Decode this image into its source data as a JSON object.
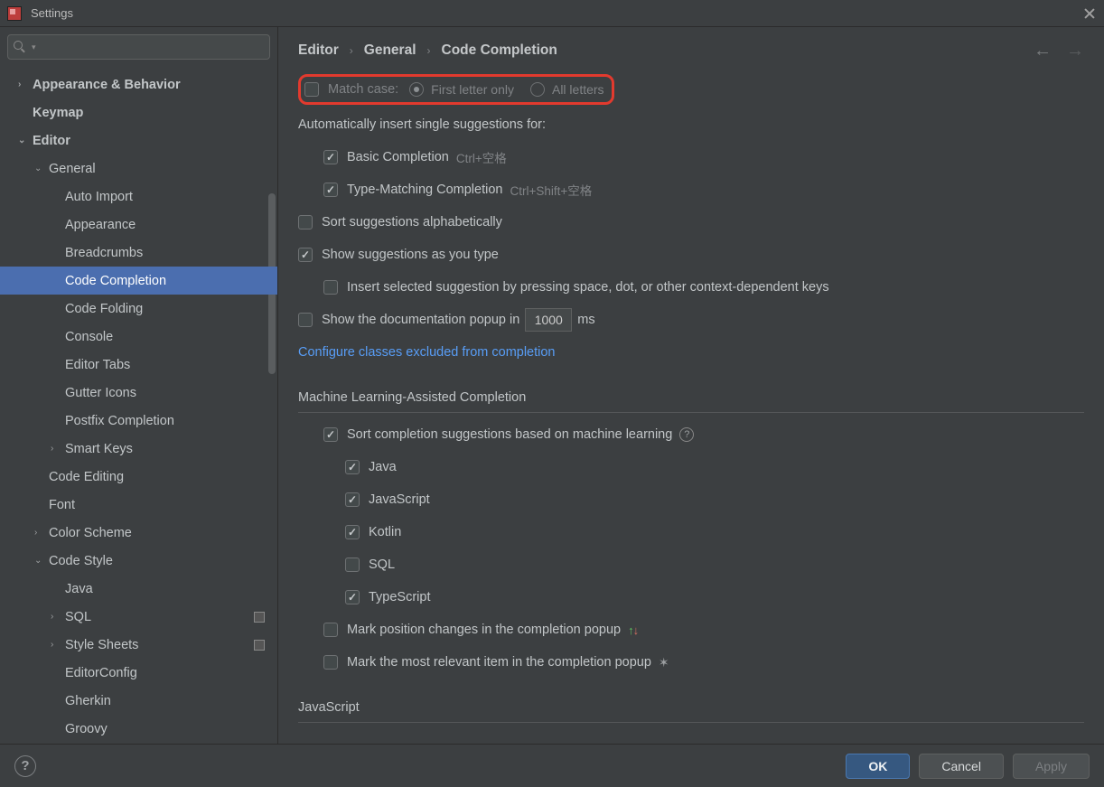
{
  "window": {
    "title": "Settings"
  },
  "sidebar": {
    "search_placeholder": "",
    "items": [
      {
        "label": "Appearance & Behavior",
        "depth": 0,
        "arrow": "right",
        "bold": true
      },
      {
        "label": "Keymap",
        "depth": 0,
        "arrow": "none",
        "bold": true
      },
      {
        "label": "Editor",
        "depth": 0,
        "arrow": "down",
        "bold": true
      },
      {
        "label": "General",
        "depth": 1,
        "arrow": "down",
        "bold": false
      },
      {
        "label": "Auto Import",
        "depth": 2,
        "arrow": "none"
      },
      {
        "label": "Appearance",
        "depth": 2,
        "arrow": "none"
      },
      {
        "label": "Breadcrumbs",
        "depth": 2,
        "arrow": "none"
      },
      {
        "label": "Code Completion",
        "depth": 2,
        "arrow": "none",
        "selected": true
      },
      {
        "label": "Code Folding",
        "depth": 2,
        "arrow": "none"
      },
      {
        "label": "Console",
        "depth": 2,
        "arrow": "none"
      },
      {
        "label": "Editor Tabs",
        "depth": 2,
        "arrow": "none"
      },
      {
        "label": "Gutter Icons",
        "depth": 2,
        "arrow": "none"
      },
      {
        "label": "Postfix Completion",
        "depth": 2,
        "arrow": "none"
      },
      {
        "label": "Smart Keys",
        "depth": 2,
        "arrow": "right"
      },
      {
        "label": "Code Editing",
        "depth": 1,
        "arrow": "none"
      },
      {
        "label": "Font",
        "depth": 1,
        "arrow": "none"
      },
      {
        "label": "Color Scheme",
        "depth": 1,
        "arrow": "right"
      },
      {
        "label": "Code Style",
        "depth": 1,
        "arrow": "down"
      },
      {
        "label": "Java",
        "depth": 2,
        "arrow": "none"
      },
      {
        "label": "SQL",
        "depth": 2,
        "arrow": "right",
        "trailing_icon": true
      },
      {
        "label": "Style Sheets",
        "depth": 2,
        "arrow": "right",
        "trailing_icon": true
      },
      {
        "label": "EditorConfig",
        "depth": 2,
        "arrow": "none"
      },
      {
        "label": "Gherkin",
        "depth": 2,
        "arrow": "none"
      },
      {
        "label": "Groovy",
        "depth": 2,
        "arrow": "none"
      }
    ]
  },
  "breadcrumb": {
    "a": "Editor",
    "b": "General",
    "c": "Code Completion"
  },
  "match_case": {
    "label": "Match case:",
    "checked": false,
    "radio_first": "First letter only",
    "radio_all": "All letters",
    "selected": "first"
  },
  "auto_insert": {
    "heading": "Automatically insert single suggestions for:",
    "basic": {
      "label": "Basic Completion",
      "hint": "Ctrl+空格",
      "checked": true
    },
    "type": {
      "label": "Type-Matching Completion",
      "hint": "Ctrl+Shift+空格",
      "checked": true
    }
  },
  "sort_alpha": {
    "label": "Sort suggestions alphabetically",
    "checked": false
  },
  "show_typing": {
    "label": "Show suggestions as you type",
    "checked": true
  },
  "insert_space": {
    "label": "Insert selected suggestion by pressing space, dot, or other context-dependent keys",
    "checked": false
  },
  "doc_popup": {
    "label_a": "Show the documentation popup in",
    "label_b": "ms",
    "value": "1000",
    "checked": false
  },
  "configure_link": "Configure classes excluded from completion",
  "ml": {
    "heading": "Machine Learning-Assisted Completion",
    "sort": {
      "label": "Sort completion suggestions based on machine learning",
      "checked": true
    },
    "langs": [
      {
        "label": "Java",
        "checked": true
      },
      {
        "label": "JavaScript",
        "checked": true
      },
      {
        "label": "Kotlin",
        "checked": true
      },
      {
        "label": "SQL",
        "checked": false
      },
      {
        "label": "TypeScript",
        "checked": true
      }
    ],
    "mark_pos": {
      "label": "Mark position changes in the completion popup",
      "checked": false
    },
    "mark_relevant": {
      "label": "Mark the most relevant item in the completion popup",
      "checked": false
    }
  },
  "js": {
    "heading": "JavaScript"
  },
  "footer": {
    "ok": "OK",
    "cancel": "Cancel",
    "apply": "Apply"
  }
}
